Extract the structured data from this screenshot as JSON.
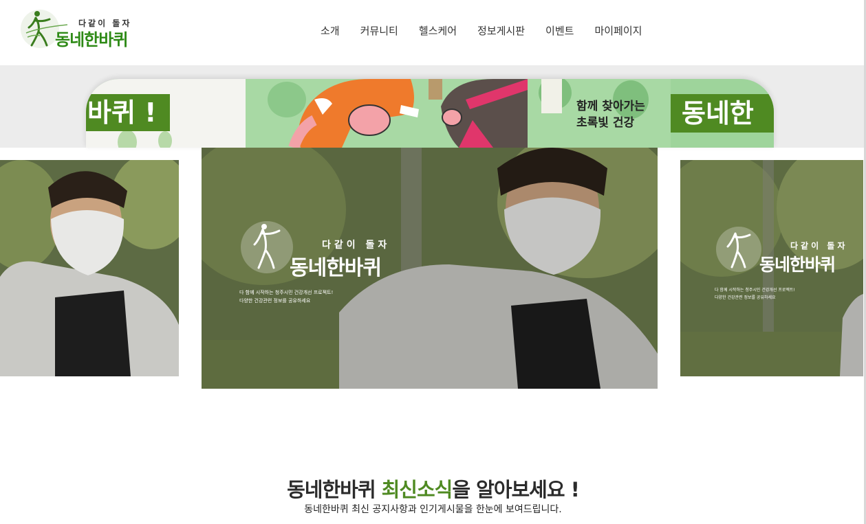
{
  "header": {
    "logo_small": "다같이 돌자",
    "logo_main": "동네한바퀴",
    "nav": [
      "소개",
      "커뮤니티",
      "헬스케어",
      "정보게시판",
      "이벤트",
      "마이페이지"
    ]
  },
  "banner": {
    "left_text": "바퀴 !",
    "right_line1": "함께 찾아가는",
    "right_line2": "초록빛 건강",
    "right_big": "동네한"
  },
  "carousel": {
    "overlay_small": "다같이 돌자",
    "overlay_main": "동네한바퀴",
    "overlay_desc1": "다 함께 시작하는 청주시민 건강개선 프로젝트!",
    "overlay_desc2": "다양한 건강관련 정보를 공유하세요"
  },
  "news": {
    "title_part1": "동네한바퀴 ",
    "title_accent": "최신소식",
    "title_part2": "을 알아보세요 !",
    "subtitle": "동네한바퀴 최신 공지사항과 인기게시물을 한눈에 보여드립니다."
  },
  "colors": {
    "brand_green": "#4f8a22",
    "logo_green": "#2e8a16",
    "band_gray": "#ececec"
  }
}
